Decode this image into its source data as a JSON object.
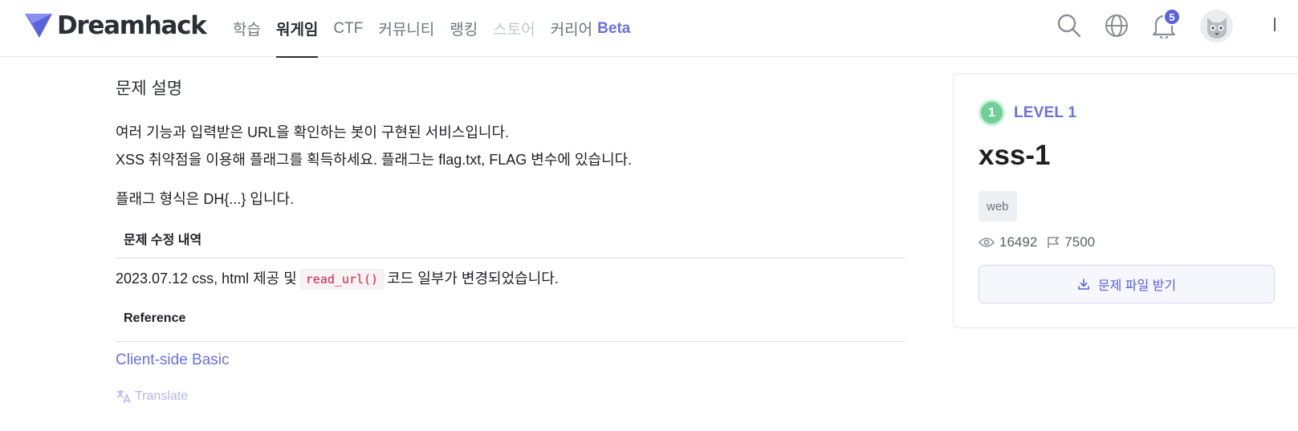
{
  "header": {
    "logo_text": "Dreamhack",
    "nav": [
      {
        "label": "학습"
      },
      {
        "label": "워게임"
      },
      {
        "label": "CTF"
      },
      {
        "label": "커뮤니티"
      },
      {
        "label": "랭킹"
      },
      {
        "label": "스토어"
      },
      {
        "label": "커리어",
        "badge": "Beta"
      }
    ],
    "active_nav": "워게임",
    "notification_count": "5",
    "icons": [
      "search-icon",
      "globe-icon",
      "bell-icon",
      "avatar"
    ]
  },
  "description": {
    "title": "문제 설명",
    "line1": "여러 기능과 입력받은 URL을 확인하는 봇이 구현된 서비스입니다.",
    "line2": "XSS 취약점을 이용해 플래그를 획득하세요. 플래그는 flag.txt, FLAG 변수에 있습니다.",
    "line3": "플래그 형식은 DH{...} 입니다.",
    "history_heading": "문제 수정 내역",
    "history_prefix": "2023.07.12 css, html 제공 및",
    "history_code": "read_url()",
    "history_suffix": "코드 일부가 변경되었습니다.",
    "reference_heading": "Reference",
    "reference_link": "Client-side Basic",
    "translate_label": "Translate"
  },
  "card": {
    "level_number": "1",
    "level_label": "LEVEL 1",
    "title": "xss-1",
    "tag": "web",
    "views": "16492",
    "solves": "7500",
    "download_label": "문제 파일 받기"
  },
  "colors": {
    "accent": "#6a70e0",
    "level_green": "#6fcf97",
    "badge": "#5a61dc",
    "code_red": "#c7254e"
  }
}
